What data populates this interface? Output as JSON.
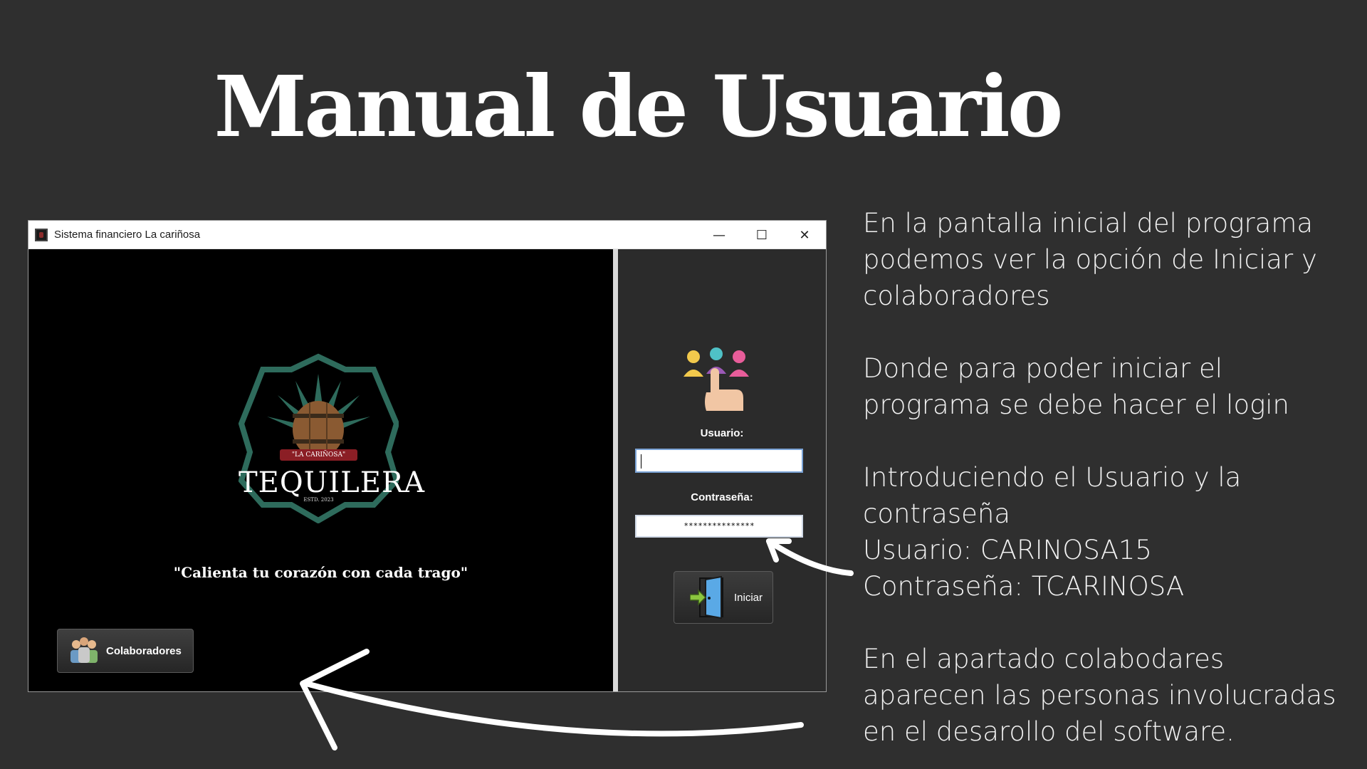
{
  "page": {
    "title": "Manual de Usuario"
  },
  "window": {
    "title": "Sistema financiero La cariñosa",
    "controls": {
      "minimize": "—",
      "maximize": "☐",
      "close": "✕"
    }
  },
  "left_panel": {
    "logo": {
      "ribbon": "\"LA CARIÑOSA\"",
      "brand": "TEQUILERA",
      "sub": "ESTD. 2023"
    },
    "slogan": "\"Calienta tu corazón con cada trago\"",
    "collab_button": {
      "label": "Colaboradores",
      "icon": "people-icon"
    }
  },
  "login": {
    "icon": "users-select-icon",
    "user_label": "Usuario:",
    "user_value": "",
    "pass_label": "Contraseña:",
    "pass_value": "***************",
    "submit_label": "Iniciar",
    "submit_icon": "door-enter-icon"
  },
  "instructions": {
    "p1": [
      "En la pantalla inicial del programa",
      "podemos ver la opción de Iniciar y",
      "colaboradores"
    ],
    "p2": [
      "Donde para poder iniciar el",
      "programa se debe hacer el login"
    ],
    "p3": [
      "Introduciendo el Usuario y la",
      "contraseña",
      "Usuario: CARINOSA15",
      "Contraseña: TCARINOSA"
    ],
    "p4": [
      "En el apartado colabodares",
      "aparecen las personas involucradas",
      "en el desarollo del software."
    ]
  },
  "colors": {
    "background": "#2f2f2f",
    "logo_green": "#2e6b5c",
    "ribbon_red": "#8b1e25"
  }
}
